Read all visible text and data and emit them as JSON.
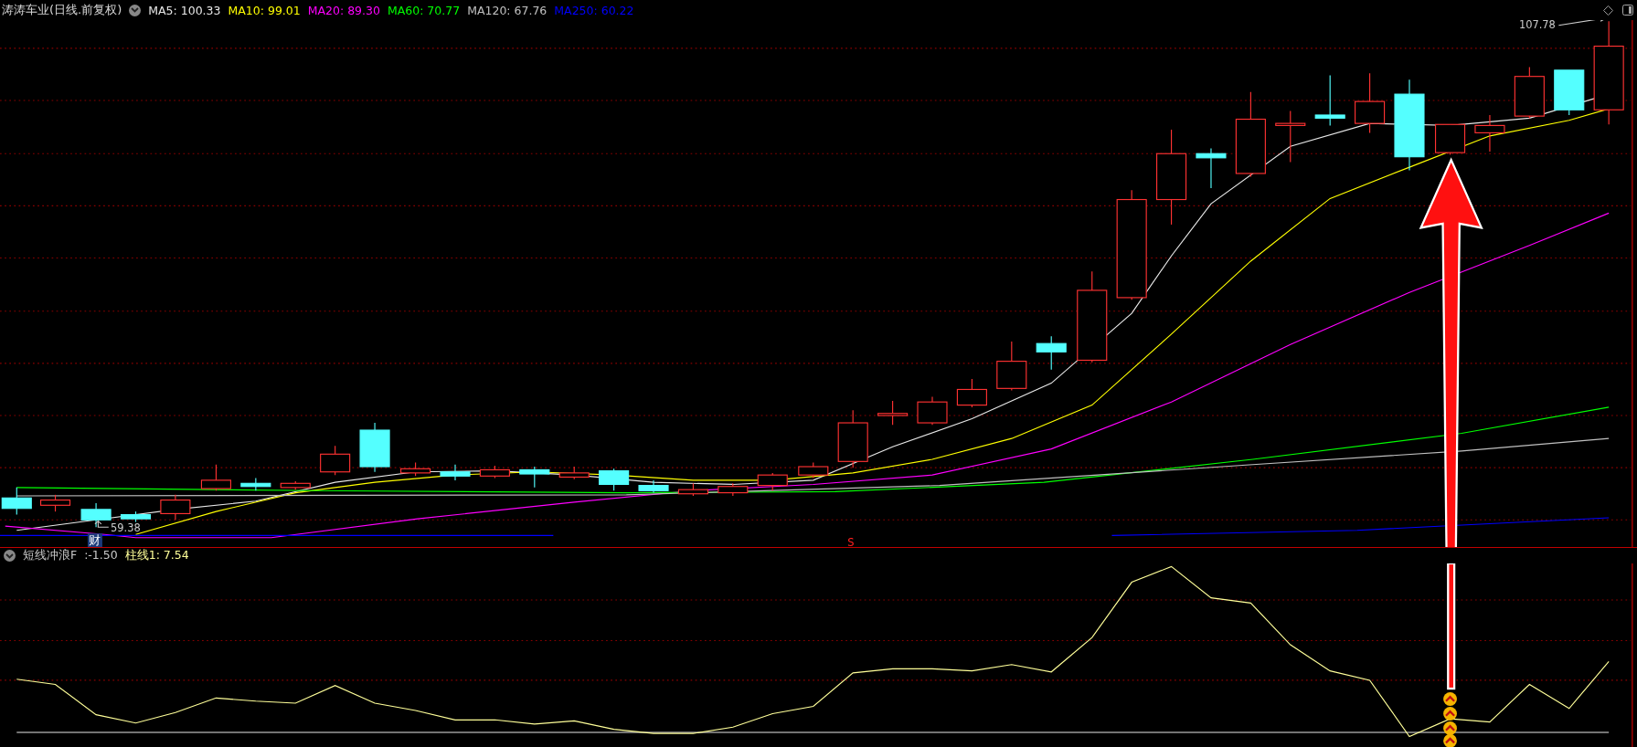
{
  "header": {
    "title": "涛涛车业(日线.前复权)",
    "ma": [
      {
        "text": "MA5: 100.33",
        "color": "#e8e8e8"
      },
      {
        "text": "MA10: 99.01",
        "color": "#ffff00"
      },
      {
        "text": "MA20: 89.30",
        "color": "#ff00ff"
      },
      {
        "text": "MA60: 70.77",
        "color": "#00ff00"
      },
      {
        "text": "MA120: 67.76",
        "color": "#c0c0c0"
      },
      {
        "text": "MA250: 60.22",
        "color": "#0000ff"
      }
    ]
  },
  "main_chart": {
    "high_label": "107.78",
    "low_label": "59.38",
    "markers": [
      {
        "kind": "finance",
        "text": "财"
      },
      {
        "kind": "signal",
        "text": "S"
      }
    ]
  },
  "indicator": {
    "items": [
      {
        "text": "短线冲浪F  :-1.50",
        "color": "#c8c8c8"
      },
      {
        "text": "柱线1: 7.54",
        "color": "#ffff99"
      }
    ]
  }
}
